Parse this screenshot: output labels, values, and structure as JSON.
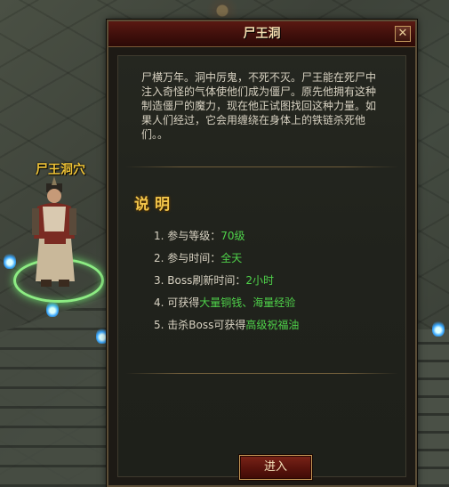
{
  "scene": {
    "npc_name": "尸王洞穴"
  },
  "dialog": {
    "title": "尸王洞",
    "close_label": "✕",
    "description": "尸横万年。洞中厉鬼，不死不灭。尸王能在死尸中注入奇怪的气体使他们成为僵尸。原先他拥有这种制造僵尸的魔力，现在他正试图找回这种力量。如果人们经过，它会用缠绕在身体上的铁链杀死他们。。",
    "section_title": "说明",
    "rules": [
      {
        "label": "1. 参与等级：",
        "value": "70级"
      },
      {
        "label": "2. 参与时间：",
        "value": "全天"
      },
      {
        "label": "3. Boss刷新时间：",
        "value": "2小时"
      },
      {
        "label": "4. 可获得",
        "value": "大量铜钱、海量经验"
      },
      {
        "label": "5. 击杀Boss可获得",
        "value": "高级祝福油"
      }
    ],
    "enter_label": "进入"
  },
  "colors": {
    "highlight_green": "#4fd24a",
    "title_gold": "#f2c54a",
    "npc_name_gold": "#f0c437"
  }
}
